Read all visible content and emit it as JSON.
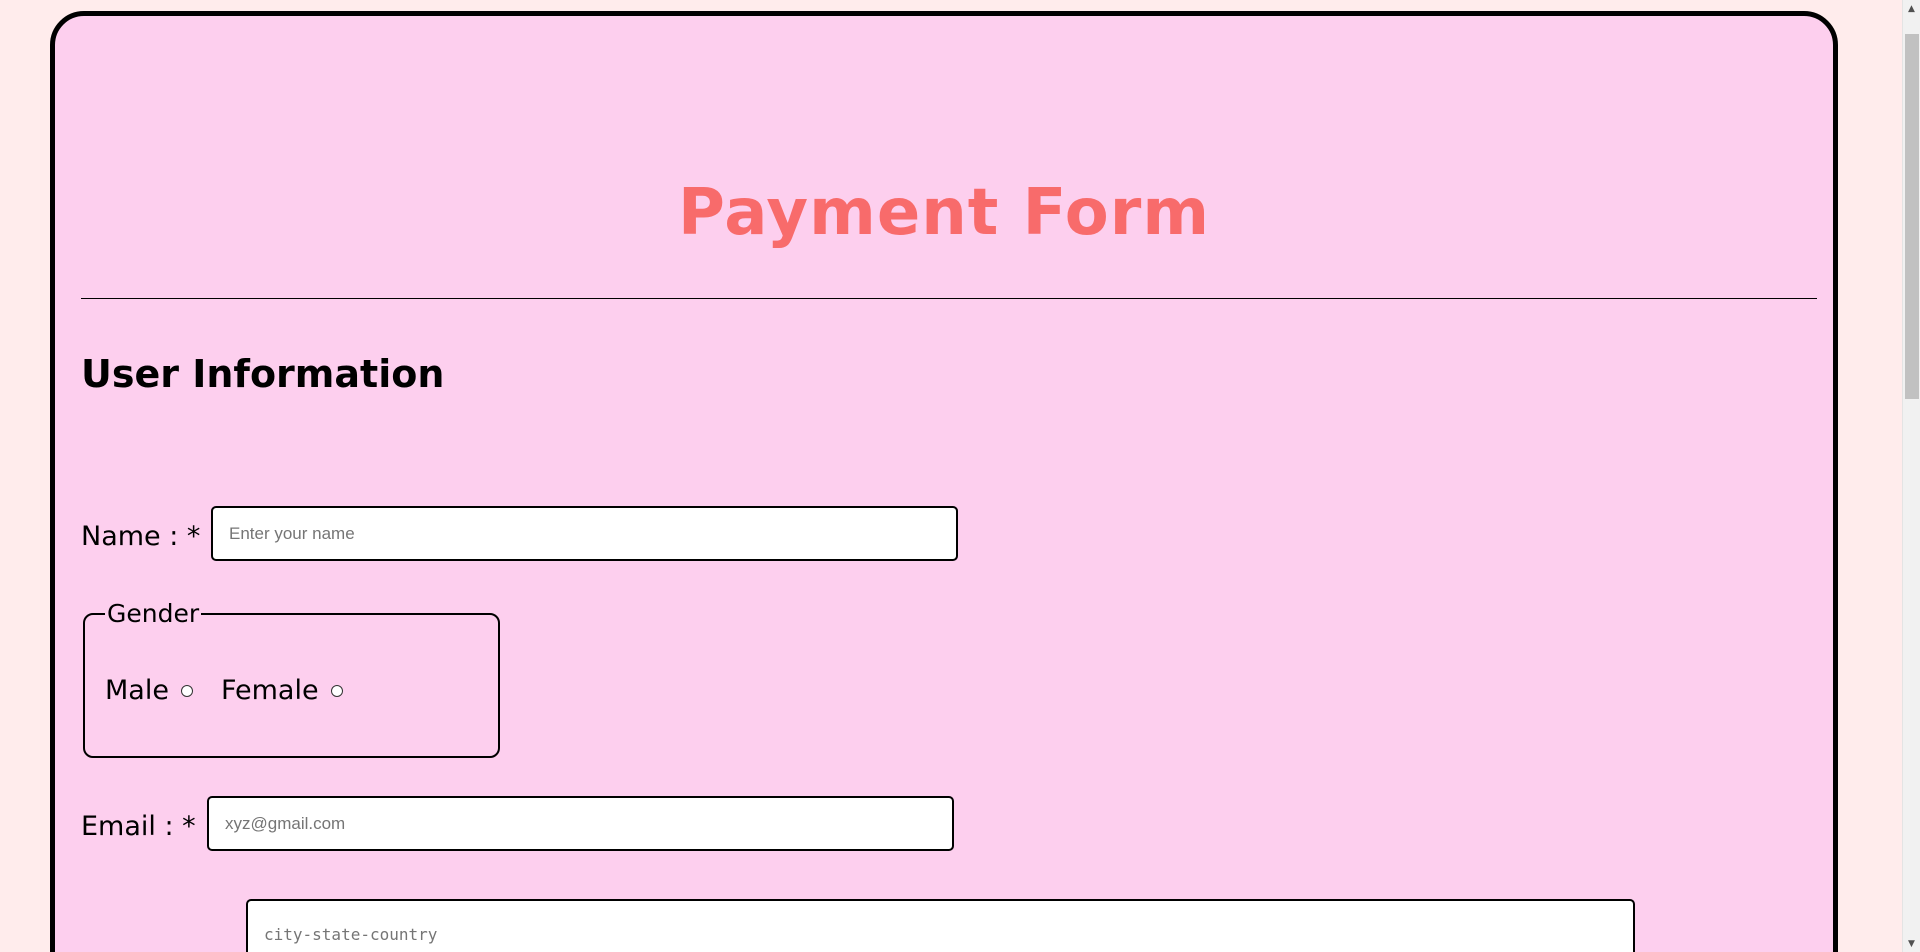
{
  "page": {
    "title": "Payment Form",
    "section_title": "User Information"
  },
  "fields": {
    "name": {
      "label": "Name : *",
      "placeholder": "Enter your name",
      "value": ""
    },
    "gender": {
      "legend": "Gender",
      "options": [
        "Male",
        "Female"
      ],
      "selected": null
    },
    "email": {
      "label": "Email : *",
      "placeholder": "xyz@gmail.com",
      "value": ""
    },
    "address": {
      "placeholder": "city-state-country",
      "value": ""
    }
  },
  "icons": {
    "scroll_up": "scroll-up-arrow-icon",
    "scroll_down": "scroll-down-arrow-icon"
  },
  "colors": {
    "page_background": "#ffecec",
    "card_background": "#fdcfee",
    "title_color": "#f86b6b",
    "border_color": "#000000"
  }
}
